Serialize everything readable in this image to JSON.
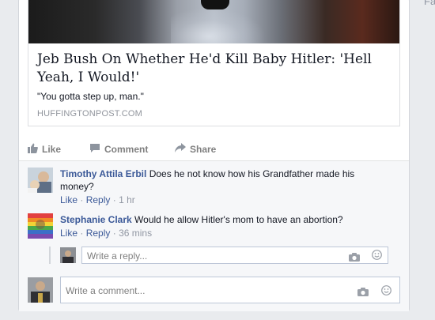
{
  "sidebar_cut_text": "Fa",
  "link_preview": {
    "title": "Jeb Bush On Whether He'd Kill Baby Hitler: 'Hell Yeah, I Would!'",
    "description": "\"You gotta step up, man.\"",
    "domain": "HUFFINGTONPOST.COM"
  },
  "actions": {
    "like": "Like",
    "comment": "Comment",
    "share": "Share"
  },
  "comments": [
    {
      "author": "Timothy Attila Erbil",
      "text": "Does he not know how his Grandfather made his money?",
      "like": "Like",
      "reply": "Reply",
      "separator": "·",
      "time": "1 hr"
    },
    {
      "author": "Stephanie Clark",
      "text": "Would he allow Hitler's mom to have an abortion?",
      "like": "Like",
      "reply": "Reply",
      "separator": "·",
      "time": "36 mins"
    }
  ],
  "reply_box": {
    "placeholder": "Write a reply..."
  },
  "comment_box": {
    "placeholder": "Write a comment..."
  },
  "colors": {
    "link": "#3b5998",
    "muted": "#9197a3",
    "background": "#e9ebee"
  },
  "icons": [
    "like-thumb-icon",
    "comment-bubble-icon",
    "share-arrow-icon",
    "camera-icon",
    "smiley-icon"
  ]
}
